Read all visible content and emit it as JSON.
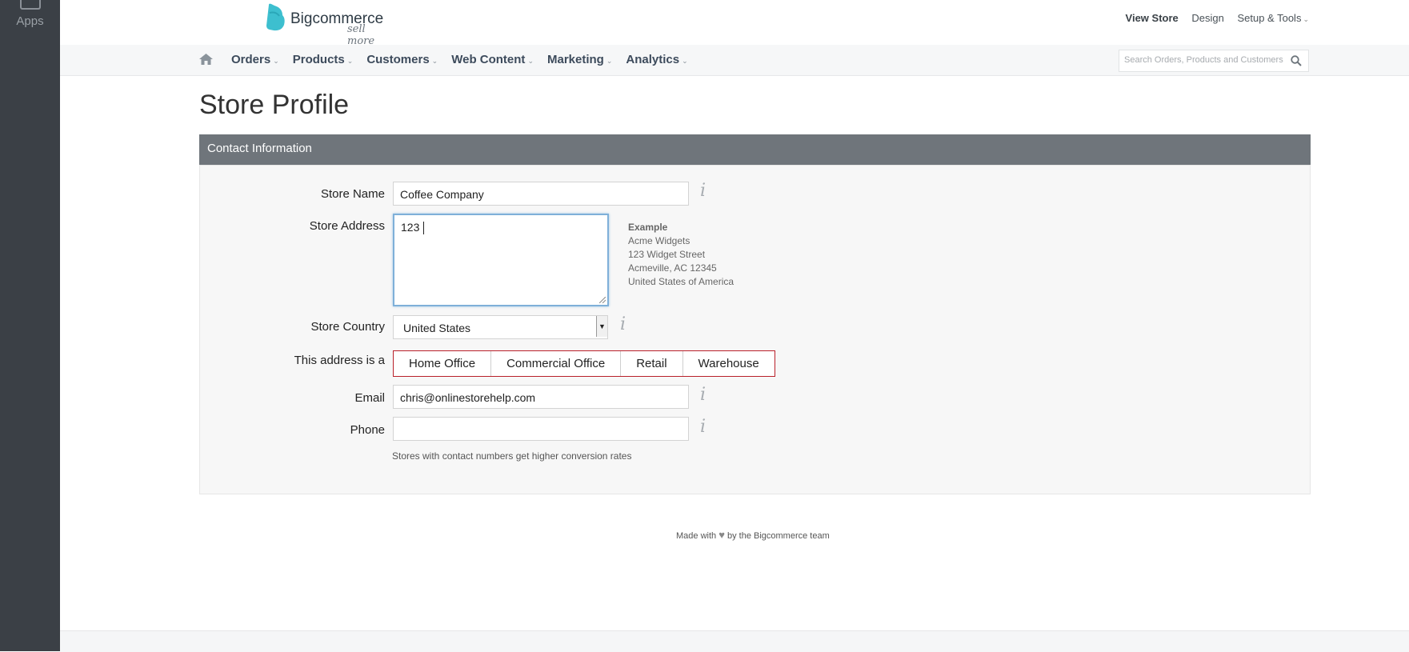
{
  "sidebar": {
    "apps_label": "Apps"
  },
  "brand": {
    "name": "Bigcommerce",
    "tagline": "sell more"
  },
  "top_links": {
    "view_store": "View Store",
    "design": "Design",
    "setup_tools": "Setup & Tools"
  },
  "nav": {
    "items": [
      "Orders",
      "Products",
      "Customers",
      "Web Content",
      "Marketing",
      "Analytics"
    ],
    "search_placeholder": "Search Orders, Products and Customers"
  },
  "page": {
    "title": "Store Profile"
  },
  "panel": {
    "title": "Contact Information"
  },
  "form": {
    "store_name": {
      "label": "Store Name",
      "value": "Coffee Company"
    },
    "store_address": {
      "label": "Store Address",
      "value": "123 "
    },
    "example": {
      "title": "Example",
      "lines": [
        "Acme Widgets",
        "123 Widget Street",
        "Acmeville, AC 12345",
        "United States of America"
      ]
    },
    "store_country": {
      "label": "Store Country",
      "value": "United States"
    },
    "address_type": {
      "label": "This address is a",
      "options": [
        "Home Office",
        "Commercial Office",
        "Retail",
        "Warehouse"
      ]
    },
    "email": {
      "label": "Email",
      "value": "chris@onlinestorehelp.com"
    },
    "phone": {
      "label": "Phone",
      "value": ""
    },
    "phone_hint": "Stores with contact numbers get higher conversion rates"
  },
  "footer": {
    "prefix": "Made with",
    "suffix": "by the Bigcommerce team"
  },
  "colors": {
    "sidebar": "#3b4046",
    "panel_header": "#6f757b",
    "accent_red": "#b9202a",
    "focus_blue": "#7fb0d9",
    "logo_teal": "#3dbfcf"
  }
}
